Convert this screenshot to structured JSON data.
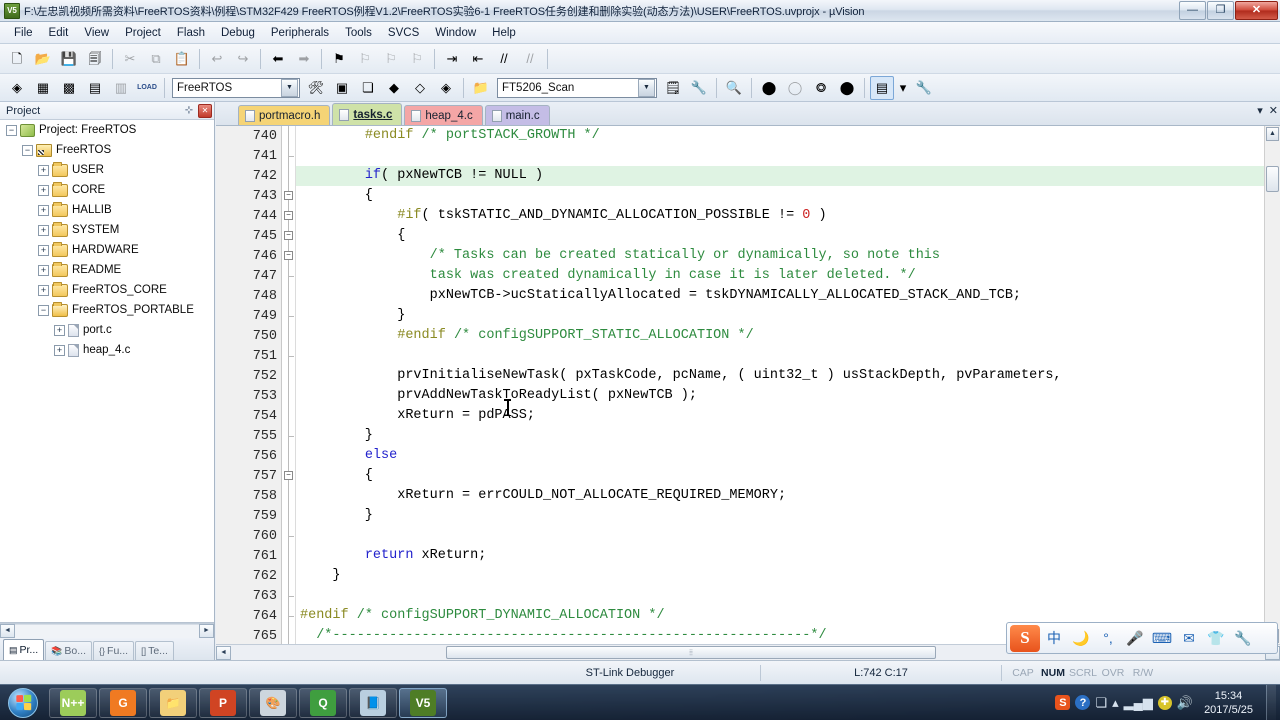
{
  "window": {
    "title": "F:\\左忠凯视频所需资料\\FreeRTOS资料\\例程\\STM32F429 FreeRTOS例程V1.2\\FreeRTOS实验6-1 FreeRTOS任务创建和删除实验(动态方法)\\USER\\FreeRTOS.uvprojx - µVision",
    "app_icon_label": "V5",
    "minimize": "—",
    "maximize": "❐",
    "close": "✕"
  },
  "menubar": {
    "items": [
      "File",
      "Edit",
      "View",
      "Project",
      "Flash",
      "Debug",
      "Peripherals",
      "Tools",
      "SVCS",
      "Window",
      "Help"
    ]
  },
  "toolbar_main": {
    "buttons": [
      {
        "name": "new-file-icon",
        "glyph": "🗋",
        "dim": false
      },
      {
        "name": "open-file-icon",
        "glyph": "📂",
        "dim": false
      },
      {
        "name": "save-icon",
        "glyph": "💾",
        "dim": false
      },
      {
        "name": "save-all-icon",
        "glyph": "🗐",
        "dim": false
      },
      {
        "name": "cut-icon",
        "glyph": "✂",
        "dim": true
      },
      {
        "name": "copy-icon",
        "glyph": "⧉",
        "dim": true
      },
      {
        "name": "paste-icon",
        "glyph": "📋",
        "dim": false
      },
      {
        "name": "undo-icon",
        "glyph": "↩",
        "dim": true
      },
      {
        "name": "redo-icon",
        "glyph": "↪",
        "dim": true
      },
      {
        "name": "navigate-backward-icon",
        "glyph": "⬅",
        "dim": false
      },
      {
        "name": "navigate-forward-icon",
        "glyph": "➡",
        "dim": true
      },
      {
        "name": "bookmark-toggle-icon",
        "glyph": "⚑",
        "dim": false
      },
      {
        "name": "bookmark-prev-icon",
        "glyph": "⚐",
        "dim": true
      },
      {
        "name": "bookmark-next-icon",
        "glyph": "⚐",
        "dim": true
      },
      {
        "name": "bookmark-clear-icon",
        "glyph": "⚐",
        "dim": true
      },
      {
        "name": "indent-icon",
        "glyph": "⇥",
        "dim": false
      },
      {
        "name": "outdent-icon",
        "glyph": "⇤",
        "dim": false
      },
      {
        "name": "comment-icon",
        "glyph": "//",
        "dim": false
      },
      {
        "name": "uncomment-icon",
        "glyph": "//",
        "dim": true
      }
    ]
  },
  "toolbar_build": {
    "buttons": [
      {
        "name": "translate-icon",
        "glyph": "◈",
        "dim": false
      },
      {
        "name": "build-icon",
        "glyph": "▦",
        "dim": false
      },
      {
        "name": "rebuild-icon",
        "glyph": "▩",
        "dim": false
      },
      {
        "name": "batch-build-icon",
        "glyph": "▤",
        "dim": false
      },
      {
        "name": "stop-build-icon",
        "glyph": "▥",
        "dim": true
      },
      {
        "name": "download-icon",
        "glyph": "LOAD",
        "dim": false
      }
    ],
    "target_select": {
      "value": "FreeRTOS",
      "name": "target-selector"
    },
    "after_buttons": [
      {
        "name": "target-options-icon",
        "glyph": "🛠",
        "dim": false
      },
      {
        "name": "manage-project-items-icon",
        "glyph": "▣",
        "dim": false
      },
      {
        "name": "manage-multi-project-icon",
        "glyph": "❏",
        "dim": false
      },
      {
        "name": "configure-packs-icon",
        "glyph": "◆",
        "dim": false
      },
      {
        "name": "pack-installer-icon",
        "glyph": "◇",
        "dim": false
      },
      {
        "name": "manage-run-time-env-icon",
        "glyph": "◈",
        "dim": false
      }
    ],
    "function_select": {
      "value": "FT5206_Scan",
      "name": "function-selector"
    },
    "tail_buttons": [
      {
        "name": "open-window-icon",
        "glyph": "🗒",
        "dim": false
      },
      {
        "name": "debug-settings-icon",
        "glyph": "🔧",
        "dim": false
      },
      {
        "name": "find-in-files-icon",
        "glyph": "🔍",
        "dim": false
      },
      {
        "name": "insert-breakpoint-icon",
        "glyph": "⬤",
        "dim": false
      },
      {
        "name": "kill-all-breakpoints-icon",
        "glyph": "◯",
        "dim": true
      },
      {
        "name": "disable-breakpoint-icon",
        "glyph": "⭗",
        "dim": false
      },
      {
        "name": "disable-all-breakpoints-icon",
        "glyph": "⬤",
        "dim": false
      },
      {
        "name": "project-window-icon",
        "glyph": "▤",
        "dim": false,
        "pressed": true
      },
      {
        "name": "project-window-dropdown-icon",
        "glyph": "▾",
        "dim": false
      },
      {
        "name": "configure-icon",
        "glyph": "🔧",
        "dim": false
      }
    ]
  },
  "project_panel": {
    "title": "Project",
    "pin_icon": "⊹",
    "close_icon": "✕",
    "tree": [
      {
        "label": "Project: FreeRTOS",
        "indent": 0,
        "expander": "−",
        "icon": "project",
        "name": "tree-node-project-root"
      },
      {
        "label": "FreeRTOS",
        "indent": 1,
        "expander": "−",
        "icon": "target",
        "name": "tree-node-target-freertos"
      },
      {
        "label": "USER",
        "indent": 2,
        "expander": "+",
        "icon": "folder",
        "name": "tree-node-group-user"
      },
      {
        "label": "CORE",
        "indent": 2,
        "expander": "+",
        "icon": "folder",
        "name": "tree-node-group-core"
      },
      {
        "label": "HALLIB",
        "indent": 2,
        "expander": "+",
        "icon": "folder",
        "name": "tree-node-group-hallib"
      },
      {
        "label": "SYSTEM",
        "indent": 2,
        "expander": "+",
        "icon": "folder",
        "name": "tree-node-group-system"
      },
      {
        "label": "HARDWARE",
        "indent": 2,
        "expander": "+",
        "icon": "folder",
        "name": "tree-node-group-hardware"
      },
      {
        "label": "README",
        "indent": 2,
        "expander": "+",
        "icon": "folder",
        "name": "tree-node-group-readme"
      },
      {
        "label": "FreeRTOS_CORE",
        "indent": 2,
        "expander": "+",
        "icon": "folder",
        "name": "tree-node-group-freertos-core"
      },
      {
        "label": "FreeRTOS_PORTABLE",
        "indent": 2,
        "expander": "−",
        "icon": "folder-open",
        "name": "tree-node-group-freertos-portable"
      },
      {
        "label": "port.c",
        "indent": 3,
        "expander": "+",
        "icon": "file",
        "name": "tree-node-file-port-c"
      },
      {
        "label": "heap_4.c",
        "indent": 3,
        "expander": "+",
        "icon": "file",
        "name": "tree-node-file-heap4-c"
      }
    ],
    "bottom_tabs": [
      {
        "label": "Pr...",
        "icon": "▤",
        "active": true,
        "name": "panel-tab-project"
      },
      {
        "label": "Bo...",
        "icon": "📚",
        "active": false,
        "name": "panel-tab-books"
      },
      {
        "label": "Fu...",
        "icon": "{}",
        "active": false,
        "name": "panel-tab-functions"
      },
      {
        "label": "Te...",
        "icon": "[]",
        "active": false,
        "name": "panel-tab-templates"
      }
    ]
  },
  "editor": {
    "tabs": [
      {
        "label": "portmacro.h",
        "color": "#f5d476",
        "active": false,
        "name": "editor-tab-portmacro-h"
      },
      {
        "label": "tasks.c",
        "color": "#cfe2a8",
        "active": true,
        "name": "editor-tab-tasks-c"
      },
      {
        "label": "heap_4.c",
        "color": "#f4a6a6",
        "active": false,
        "name": "editor-tab-heap4-c"
      },
      {
        "label": "main.c",
        "color": "#c4bde6",
        "active": false,
        "name": "editor-tab-main-c"
      }
    ],
    "tab_dropdown_icon": "▾",
    "tab_close_icon": "✕",
    "first_line_number": 740,
    "highlight_line": 742,
    "fold_lines": [
      743,
      744,
      745,
      746,
      757
    ],
    "tick_lines": [
      741,
      747,
      749,
      751,
      755,
      760,
      763,
      764
    ],
    "lines": [
      {
        "n": 740,
        "tokens": [
          {
            "t": "        ",
            "c": ""
          },
          {
            "t": "#endif",
            "c": "pp"
          },
          {
            "t": " ",
            "c": ""
          },
          {
            "t": "/* portSTACK_GROWTH */",
            "c": "cm"
          }
        ]
      },
      {
        "n": 741,
        "tokens": []
      },
      {
        "n": 742,
        "tokens": [
          {
            "t": "        ",
            "c": ""
          },
          {
            "t": "if",
            "c": "kw"
          },
          {
            "t": "( pxNewTCB != NULL )",
            "c": ""
          }
        ]
      },
      {
        "n": 743,
        "tokens": [
          {
            "t": "        {",
            "c": ""
          }
        ]
      },
      {
        "n": 744,
        "tokens": [
          {
            "t": "            ",
            "c": ""
          },
          {
            "t": "#if",
            "c": "pp"
          },
          {
            "t": "( tskSTATIC_AND_DYNAMIC_ALLOCATION_POSSIBLE != ",
            "c": ""
          },
          {
            "t": "0",
            "c": "num"
          },
          {
            "t": " )",
            "c": ""
          }
        ]
      },
      {
        "n": 745,
        "tokens": [
          {
            "t": "            {",
            "c": ""
          }
        ]
      },
      {
        "n": 746,
        "tokens": [
          {
            "t": "                ",
            "c": ""
          },
          {
            "t": "/* Tasks can be created statically or dynamically, so note this",
            "c": "cm"
          }
        ]
      },
      {
        "n": 747,
        "tokens": [
          {
            "t": "                ",
            "c": ""
          },
          {
            "t": "task was created dynamically in case it is later deleted. */",
            "c": "cm"
          }
        ]
      },
      {
        "n": 748,
        "tokens": [
          {
            "t": "                pxNewTCB->ucStaticallyAllocated = tskDYNAMICALLY_ALLOCATED_STACK_AND_TCB;",
            "c": ""
          }
        ]
      },
      {
        "n": 749,
        "tokens": [
          {
            "t": "            }",
            "c": ""
          }
        ]
      },
      {
        "n": 750,
        "tokens": [
          {
            "t": "            ",
            "c": ""
          },
          {
            "t": "#endif",
            "c": "pp"
          },
          {
            "t": " ",
            "c": ""
          },
          {
            "t": "/* configSUPPORT_STATIC_ALLOCATION */",
            "c": "cm"
          }
        ]
      },
      {
        "n": 751,
        "tokens": []
      },
      {
        "n": 752,
        "tokens": [
          {
            "t": "            prvInitialiseNewTask( pxTaskCode, pcName, ( uint32_t ) usStackDepth, pvParameters,",
            "c": ""
          }
        ]
      },
      {
        "n": 753,
        "tokens": [
          {
            "t": "            prvAddNewTaskToReadyList( pxNewTCB );",
            "c": ""
          }
        ]
      },
      {
        "n": 754,
        "tokens": [
          {
            "t": "            xReturn = pdPASS;",
            "c": ""
          }
        ]
      },
      {
        "n": 755,
        "tokens": [
          {
            "t": "        }",
            "c": ""
          }
        ]
      },
      {
        "n": 756,
        "tokens": [
          {
            "t": "        ",
            "c": ""
          },
          {
            "t": "else",
            "c": "kw"
          }
        ]
      },
      {
        "n": 757,
        "tokens": [
          {
            "t": "        {",
            "c": ""
          }
        ]
      },
      {
        "n": 758,
        "tokens": [
          {
            "t": "            xReturn = errCOULD_NOT_ALLOCATE_REQUIRED_MEMORY;",
            "c": ""
          }
        ]
      },
      {
        "n": 759,
        "tokens": [
          {
            "t": "        }",
            "c": ""
          }
        ]
      },
      {
        "n": 760,
        "tokens": []
      },
      {
        "n": 761,
        "tokens": [
          {
            "t": "        ",
            "c": ""
          },
          {
            "t": "return",
            "c": "kw"
          },
          {
            "t": " xReturn;",
            "c": ""
          }
        ]
      },
      {
        "n": 762,
        "tokens": [
          {
            "t": "    }",
            "c": ""
          }
        ]
      },
      {
        "n": 763,
        "tokens": []
      },
      {
        "n": 764,
        "tokens": [
          {
            "t": "",
            "c": ""
          },
          {
            "t": "#endif",
            "c": "pp"
          },
          {
            "t": " ",
            "c": ""
          },
          {
            "t": "/* configSUPPORT_DYNAMIC_ALLOCATION */",
            "c": "cm"
          }
        ]
      },
      {
        "n": 765,
        "tokens": [
          {
            "t": "  ",
            "c": ""
          },
          {
            "t": "/*-----------------------------------------------------------*/",
            "c": "cm"
          }
        ]
      }
    ],
    "hscroll_thumb_glyph": "⦙⦙"
  },
  "statusbar": {
    "debugger": "ST-Link Debugger",
    "cursor_position": "L:742 C:17",
    "indicators": [
      {
        "label": "CAP",
        "active": false,
        "name": "status-indicator-caps"
      },
      {
        "label": "NUM",
        "active": true,
        "name": "status-indicator-num"
      },
      {
        "label": "SCRL",
        "active": false,
        "name": "status-indicator-scroll"
      },
      {
        "label": "OVR",
        "active": false,
        "name": "status-indicator-overwrite"
      },
      {
        "label": "R/W",
        "active": false,
        "name": "status-indicator-readwrite"
      }
    ]
  },
  "ime_bar": {
    "logo": "S",
    "items": [
      {
        "glyph": "中",
        "name": "ime-chinese-mode-icon"
      },
      {
        "glyph": "🌙",
        "name": "ime-halfwidth-icon"
      },
      {
        "glyph": "°,",
        "name": "ime-punctuation-icon"
      },
      {
        "glyph": "🎤",
        "name": "ime-voice-input-icon"
      },
      {
        "glyph": "⌨",
        "name": "ime-soft-keyboard-icon"
      },
      {
        "glyph": "✉",
        "name": "ime-inbox-icon"
      },
      {
        "glyph": "👕",
        "name": "ime-skin-icon"
      },
      {
        "glyph": "🔧",
        "name": "ime-toolbox-icon"
      }
    ]
  },
  "taskbar": {
    "start_label": "Start",
    "apps": [
      {
        "name": "taskbar-app-notepadpp",
        "label": "N++",
        "bg": "#9ccc5a",
        "active": false
      },
      {
        "name": "taskbar-app-foxit-pdf",
        "label": "G",
        "bg": "#f07a22",
        "active": false
      },
      {
        "name": "taskbar-app-explorer",
        "label": "📁",
        "bg": "#f2d07a",
        "active": false
      },
      {
        "name": "taskbar-app-powerpoint",
        "label": "P",
        "bg": "#d04423",
        "active": false
      },
      {
        "name": "taskbar-app-paint",
        "label": "🎨",
        "bg": "#cdd6de",
        "active": false
      },
      {
        "name": "taskbar-app-qq",
        "label": "Q",
        "bg": "#3f9e3f",
        "active": false
      },
      {
        "name": "taskbar-app-notes",
        "label": "📘",
        "bg": "#b9cfe0",
        "active": false
      },
      {
        "name": "taskbar-app-uvision",
        "label": "V5",
        "bg": "#4e7d26",
        "active": true
      }
    ],
    "tray": [
      {
        "glyph": "S",
        "name": "tray-sogou-icon",
        "color": "#e8531c"
      },
      {
        "glyph": "?",
        "name": "tray-help-icon",
        "color": "#2b6fc4"
      },
      {
        "glyph": "❏",
        "name": "tray-network-flyout-icon",
        "color": "#d6e2ee"
      },
      {
        "glyph": "▴",
        "name": "tray-show-hidden-icons",
        "color": "#d6e2ee"
      },
      {
        "glyph": "▂▄▆",
        "name": "tray-network-signal-icon",
        "color": "#d6e2ee"
      },
      {
        "glyph": "✚",
        "name": "tray-action-center-icon",
        "color": "#d8c42a"
      },
      {
        "glyph": "🔊",
        "name": "tray-volume-icon",
        "color": "#d6e2ee"
      }
    ],
    "clock_time": "15:34",
    "clock_date": "2017/5/25"
  }
}
